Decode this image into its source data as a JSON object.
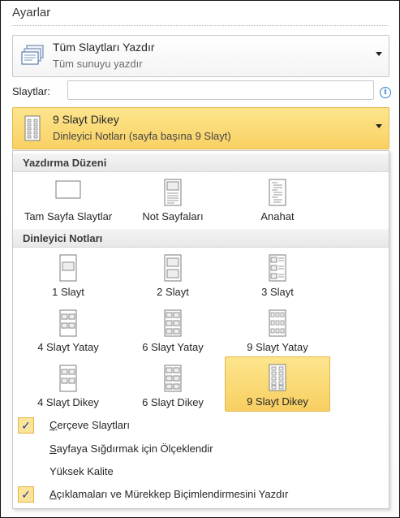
{
  "heading": "Ayarlar",
  "print_range": {
    "title": "Tüm Slaytları Yazdır",
    "subtitle": "Tüm sunuyu yazdır",
    "icon": "print-all-slides-icon"
  },
  "slides": {
    "label": "Slaytlar:",
    "value": "",
    "placeholder": "",
    "info_icon": "info-icon"
  },
  "layout_dropdown": {
    "title": "9 Slayt Dikey",
    "subtitle": "Dinleyici Notları (sayfa başına 9 Slayt)",
    "icon": "nine-slides-vertical-icon",
    "accent": "#f9d164"
  },
  "menu": {
    "print_layout_header": "Yazdırma Düzeni",
    "print_layout_items": [
      {
        "label": "Tam Sayfa Slaytlar",
        "icon": "full-page-slide-icon"
      },
      {
        "label": "Not Sayfaları",
        "icon": "notes-pages-icon"
      },
      {
        "label": "Anahat",
        "icon": "outline-icon"
      }
    ],
    "handouts_header": "Dinleyici Notları",
    "handout_items": [
      {
        "label": "1 Slayt",
        "icon": "one-slide-icon"
      },
      {
        "label": "2 Slayt",
        "icon": "two-slides-icon"
      },
      {
        "label": "3 Slayt",
        "icon": "three-slides-icon"
      },
      {
        "label": "4 Slayt Yatay",
        "icon": "four-slides-horizontal-icon"
      },
      {
        "label": "6 Slayt Yatay",
        "icon": "six-slides-horizontal-icon"
      },
      {
        "label": "9 Slayt Yatay",
        "icon": "nine-slides-horizontal-icon"
      },
      {
        "label": "4 Slayt Dikey",
        "icon": "four-slides-vertical-icon"
      },
      {
        "label": "6 Slayt Dikey",
        "icon": "six-slides-vertical-icon"
      },
      {
        "label": "9 Slayt Dikey",
        "icon": "nine-slides-vertical-icon",
        "selected": true
      }
    ],
    "options": [
      {
        "label": "Çerçeve Slaytları",
        "access_key": "Ç",
        "rest": "erçeve Slaytları",
        "checked": true
      },
      {
        "label": "Sayfaya Sığdırmak için Ölçeklendir",
        "access_key": "S",
        "rest": "ayfaya Sığdırmak için Ölçeklendir",
        "checked": false
      },
      {
        "label": "Yüksek Kalite",
        "access_key": "",
        "rest": "Yüksek Kalite",
        "checked": false
      },
      {
        "label": "Açıklamaları ve Mürekkep Biçimlendirmesini Yazdır",
        "access_key": "A",
        "rest": "çıklamaları ve Mürekkep Biçimlendirmesini Yazdır",
        "checked": true
      }
    ],
    "check_glyph": "✓"
  }
}
